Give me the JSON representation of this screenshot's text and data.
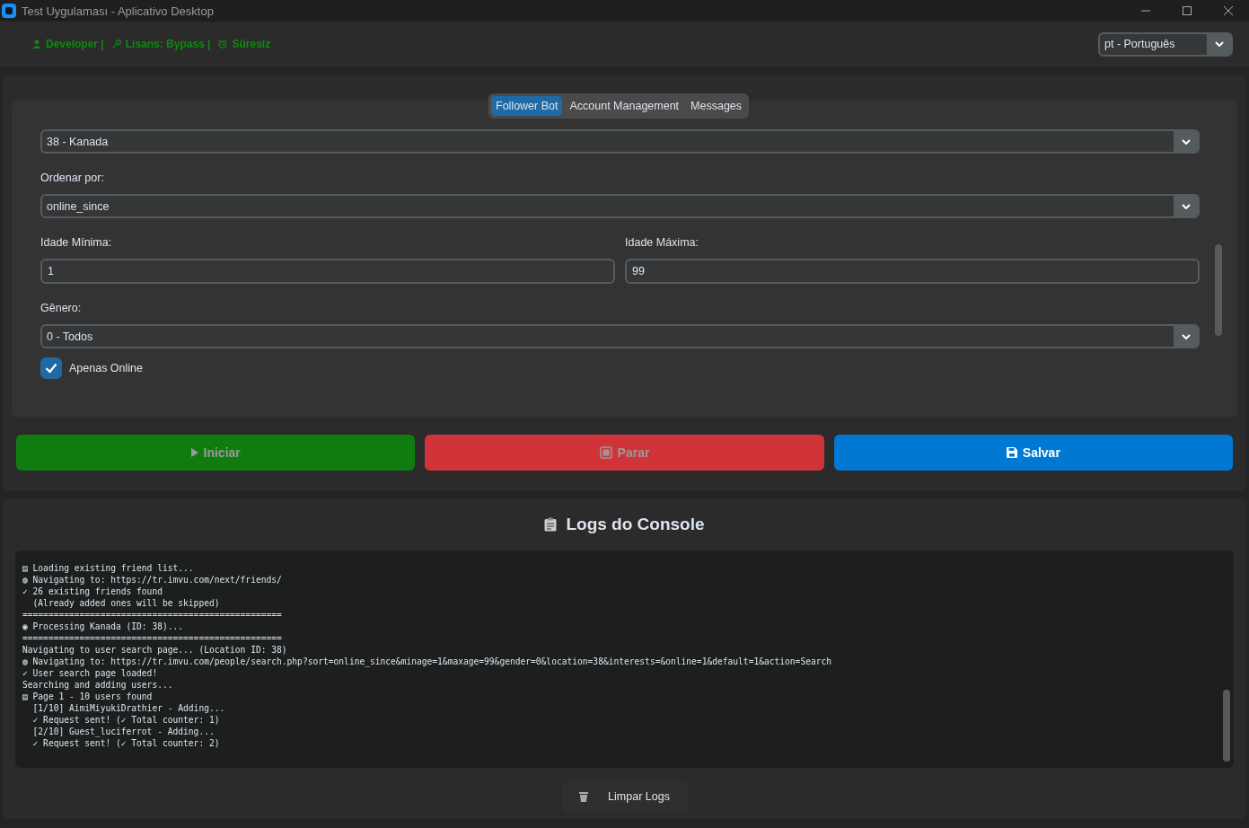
{
  "window": {
    "title": "Test Uygulaması - Aplicativo Desktop"
  },
  "header": {
    "status": [
      {
        "kind": "person",
        "text": "Developer |"
      },
      {
        "kind": "key",
        "text": "Lisans: Bypass |"
      },
      {
        "kind": "clock",
        "text": "Süresiz"
      }
    ],
    "language": {
      "value": "pt - Português"
    }
  },
  "tabs": [
    {
      "label": "Follower Bot",
      "selected": true
    },
    {
      "label": "Account Management",
      "selected": false
    },
    {
      "label": "Messages",
      "selected": false
    }
  ],
  "form": {
    "fields": [
      {
        "kind": "select",
        "value": "38 - Kanada"
      },
      {
        "kind": "select",
        "label": "Ordenar por:",
        "value": "online_since"
      },
      {
        "kind": "pair",
        "items": [
          {
            "label": "Idade Mínima:",
            "value": "1"
          },
          {
            "label": "Idade Máxima:",
            "value": "99"
          }
        ]
      },
      {
        "kind": "select",
        "label": "Gênero:",
        "value": "0 - Todos"
      },
      {
        "kind": "checkbox",
        "label": "Apenas Online",
        "checked": true
      }
    ]
  },
  "buttons": [
    {
      "kind": "start",
      "label": "Iniciar",
      "disabled": true
    },
    {
      "kind": "stop",
      "label": "Parar",
      "disabled": true
    },
    {
      "kind": "save",
      "label": "Salvar",
      "disabled": false
    }
  ],
  "logs": {
    "title": "Logs do Console",
    "lines": [
      "▤ Loading existing friend list...",
      "◍ Navigating to: https://tr.imvu.com/next/friends/",
      "✓ 26 existing friends found",
      "  (Already added ones will be skipped)",
      "==================================================",
      "◉ Processing Kanada (ID: 38)...",
      "==================================================",
      "Navigating to user search page... (Location ID: 38)",
      "◍ Navigating to: https://tr.imvu.com/people/search.php?sort=online_since&minage=1&maxage=99&gender=0&location=38&interests=&online=1&default=1&action=Search",
      "✓ User search page loaded!",
      "Searching and adding users...",
      "▤ Page 1 - 10 users found",
      "  [1/10] AimiMiyukiDrathier - Adding...",
      "  ✓ Request sent! (✓ Total counter: 1)",
      "  [2/10] Guest_luciferrot - Adding...",
      "  ✓ Request sent! (✓ Total counter: 2)"
    ],
    "clear_button": "Limpar Logs"
  }
}
